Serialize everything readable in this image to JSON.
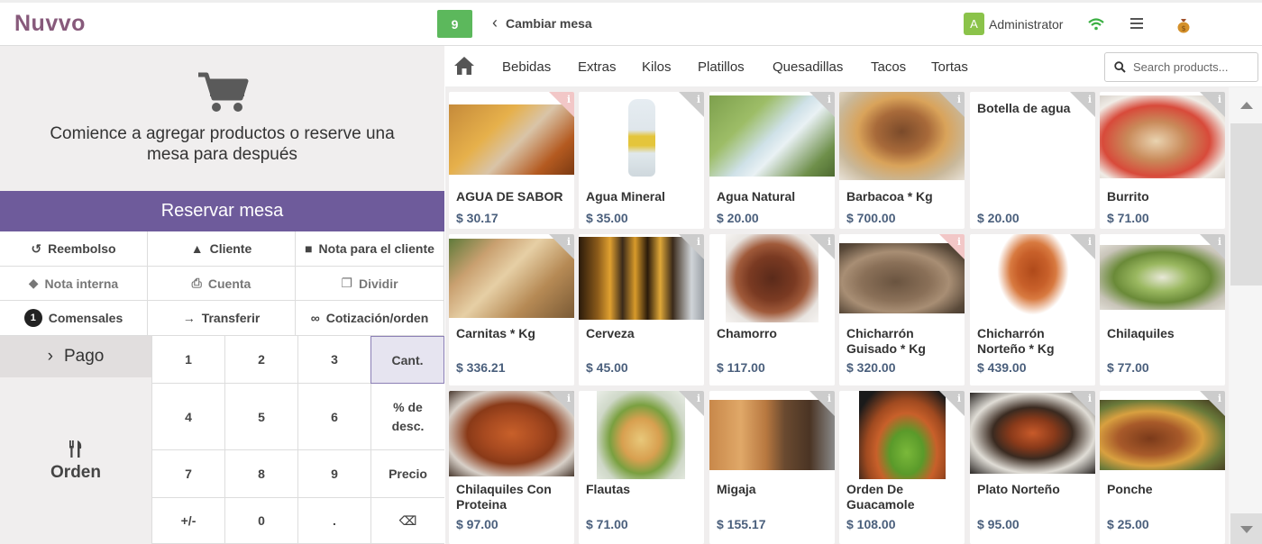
{
  "header": {
    "logo": "Nuvvo",
    "table_number": "9",
    "change_table": "Cambiar mesa",
    "user_initial": "A",
    "user_name": "Administrator"
  },
  "order": {
    "empty_message": "Comience a agregar productos o reserve una mesa para después",
    "reserve_button": "Reservar mesa"
  },
  "controls": {
    "refund": "Reembolso",
    "customer": "Cliente",
    "customer_note": "Nota para el cliente",
    "internal_note": "Nota interna",
    "bill": "Cuenta",
    "split": "Dividir",
    "guests_count": "1",
    "guests": "Comensales",
    "transfer": "Transferir",
    "quotation": "Cotización/orden"
  },
  "payment": {
    "pay": "Pago",
    "order": "Orden"
  },
  "numpad": {
    "k1": "1",
    "k2": "2",
    "k3": "3",
    "qty": "Cant.",
    "k4": "4",
    "k5": "5",
    "k6": "6",
    "disc": "% de desc.",
    "k7": "7",
    "k8": "8",
    "k9": "9",
    "price": "Precio",
    "sign": "+/-",
    "k0": "0",
    "dot": ".",
    "back": "⌫"
  },
  "categories": [
    "Bebidas",
    "Extras",
    "Kilos",
    "Platillos",
    "Quesadillas",
    "Tacos",
    "Tortas"
  ],
  "search": {
    "placeholder": "Search products..."
  },
  "products": [
    {
      "name": "AGUA DE SABOR",
      "price": "$ 30.17"
    },
    {
      "name": "Agua Mineral",
      "price": "$ 35.00"
    },
    {
      "name": "Agua Natural",
      "price": "$ 20.00"
    },
    {
      "name": "Barbacoa * Kg",
      "price": "$ 700.00"
    },
    {
      "name": "Botella de agua",
      "price": "$ 20.00"
    },
    {
      "name": "Burrito",
      "price": "$ 71.00"
    },
    {
      "name": "Carnitas * Kg",
      "price": "$ 336.21"
    },
    {
      "name": "Cerveza",
      "price": "$ 45.00"
    },
    {
      "name": "Chamorro",
      "price": "$ 117.00"
    },
    {
      "name": "Chicharrón Guisado * Kg",
      "price": "$ 320.00"
    },
    {
      "name": "Chicharrón Norteño * Kg",
      "price": "$ 439.00"
    },
    {
      "name": "Chilaquiles",
      "price": "$ 77.00"
    },
    {
      "name": "Chilaquiles Con Proteina",
      "price": "$ 97.00"
    },
    {
      "name": "Flautas",
      "price": "$ 71.00"
    },
    {
      "name": "Migaja",
      "price": "$ 155.17"
    },
    {
      "name": "Orden De Guacamole",
      "price": "$ 108.00"
    },
    {
      "name": "Plato Norteño",
      "price": "$ 95.00"
    },
    {
      "name": "Ponche",
      "price": "$ 25.00"
    }
  ],
  "colors": {
    "brand": "#875a7b",
    "accent": "#6e5b9b",
    "badge": "#5cb85c",
    "price": "#4a5f7c"
  }
}
